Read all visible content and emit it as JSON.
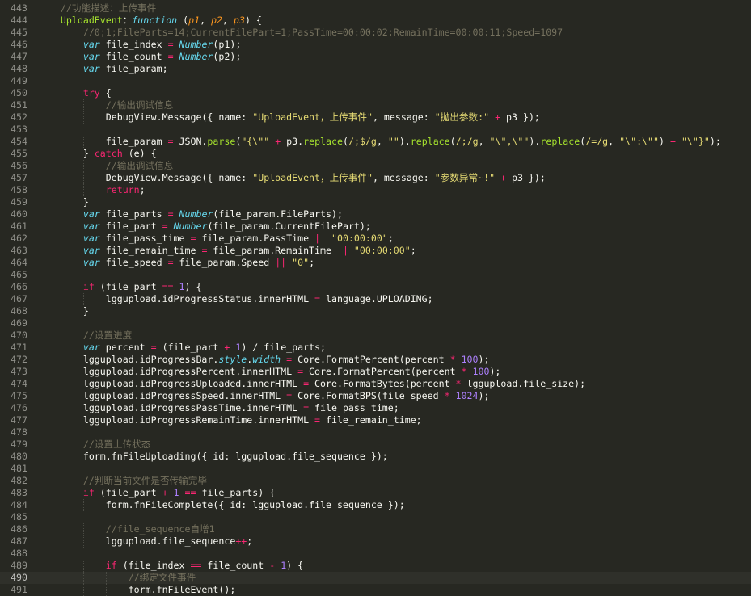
{
  "editor": {
    "current_line": "490",
    "lines": [
      {
        "no": "443",
        "ind": 4,
        "t": [
          [
            "c",
            "//功能描述：上传事件"
          ]
        ]
      },
      {
        "no": "444",
        "ind": 4,
        "t": [
          [
            "f",
            "UploadEvent"
          ],
          [
            "",
            "："
          ],
          [
            "b",
            "function"
          ],
          [
            "",
            " ("
          ],
          [
            "p",
            "p1"
          ],
          [
            "",
            ", "
          ],
          [
            "p",
            "p2"
          ],
          [
            "",
            ", "
          ],
          [
            "p",
            "p3"
          ],
          [
            "",
            ") {"
          ]
        ]
      },
      {
        "no": "445",
        "ind": 8,
        "t": [
          [
            "c",
            "//0;1;FileParts=14;CurrentFilePart=1;PassTime=00:00:02;RemainTime=00:00:11;Speed=1097"
          ]
        ]
      },
      {
        "no": "446",
        "ind": 8,
        "t": [
          [
            "b",
            "var"
          ],
          [
            "",
            " file_index "
          ],
          [
            "k",
            "="
          ],
          [
            "",
            " "
          ],
          [
            "b",
            "Number"
          ],
          [
            "",
            "(p1);"
          ]
        ]
      },
      {
        "no": "447",
        "ind": 8,
        "t": [
          [
            "b",
            "var"
          ],
          [
            "",
            " file_count "
          ],
          [
            "k",
            "="
          ],
          [
            "",
            " "
          ],
          [
            "b",
            "Number"
          ],
          [
            "",
            "(p2);"
          ]
        ]
      },
      {
        "no": "448",
        "ind": 8,
        "t": [
          [
            "b",
            "var"
          ],
          [
            "",
            " file_param;"
          ]
        ]
      },
      {
        "no": "449",
        "ind": 0,
        "t": []
      },
      {
        "no": "450",
        "ind": 8,
        "t": [
          [
            "k",
            "try"
          ],
          [
            "",
            " {"
          ]
        ]
      },
      {
        "no": "451",
        "ind": 12,
        "t": [
          [
            "c",
            "//输出调试信息"
          ]
        ]
      },
      {
        "no": "452",
        "ind": 12,
        "t": [
          [
            "",
            "DebugView.Message({ name: "
          ],
          [
            "s",
            "\"UploadEvent，上传事件\""
          ],
          [
            "",
            ", message: "
          ],
          [
            "s",
            "\"抛出参数:\""
          ],
          [
            "",
            " "
          ],
          [
            "k",
            "+"
          ],
          [
            "",
            " p3 });"
          ]
        ]
      },
      {
        "no": "453",
        "ind": 0,
        "t": []
      },
      {
        "no": "454",
        "ind": 12,
        "t": [
          [
            "",
            "file_param "
          ],
          [
            "k",
            "="
          ],
          [
            "",
            " JSON."
          ],
          [
            "f",
            "parse"
          ],
          [
            "",
            "("
          ],
          [
            "s",
            "\"{\\\"\""
          ],
          [
            "",
            " "
          ],
          [
            "k",
            "+"
          ],
          [
            "",
            " p3."
          ],
          [
            "f",
            "replace"
          ],
          [
            "",
            "("
          ],
          [
            "s",
            "/;$/g"
          ],
          [
            "",
            ", "
          ],
          [
            "s",
            "\"\""
          ],
          [
            "",
            ")."
          ],
          [
            "f",
            "replace"
          ],
          [
            "",
            "("
          ],
          [
            "s",
            "/;/g"
          ],
          [
            "",
            ", "
          ],
          [
            "s",
            "\"\\\",\\\"\""
          ],
          [
            "",
            ")."
          ],
          [
            "f",
            "replace"
          ],
          [
            "",
            "("
          ],
          [
            "s",
            "/=/g"
          ],
          [
            "",
            ", "
          ],
          [
            "s",
            "\"\\\":\\\"\""
          ],
          [
            "",
            ") "
          ],
          [
            "k",
            "+"
          ],
          [
            "",
            " "
          ],
          [
            "s",
            "\"\\\"}\""
          ],
          [
            "",
            ");"
          ]
        ]
      },
      {
        "no": "455",
        "ind": 8,
        "t": [
          [
            "",
            "} "
          ],
          [
            "k",
            "catch"
          ],
          [
            "",
            " (e) {"
          ]
        ]
      },
      {
        "no": "456",
        "ind": 12,
        "t": [
          [
            "c",
            "//输出调试信息"
          ]
        ]
      },
      {
        "no": "457",
        "ind": 12,
        "t": [
          [
            "",
            "DebugView.Message({ name: "
          ],
          [
            "s",
            "\"UploadEvent，上传事件\""
          ],
          [
            "",
            ", message: "
          ],
          [
            "s",
            "\"参数异常~!\""
          ],
          [
            "",
            " "
          ],
          [
            "k",
            "+"
          ],
          [
            "",
            " p3 });"
          ]
        ]
      },
      {
        "no": "458",
        "ind": 12,
        "t": [
          [
            "k",
            "return"
          ],
          [
            "",
            ";"
          ]
        ]
      },
      {
        "no": "459",
        "ind": 8,
        "t": [
          [
            "",
            "}"
          ]
        ]
      },
      {
        "no": "460",
        "ind": 8,
        "t": [
          [
            "b",
            "var"
          ],
          [
            "",
            " file_parts "
          ],
          [
            "k",
            "="
          ],
          [
            "",
            " "
          ],
          [
            "b",
            "Number"
          ],
          [
            "",
            "(file_param.FileParts);"
          ]
        ]
      },
      {
        "no": "461",
        "ind": 8,
        "t": [
          [
            "b",
            "var"
          ],
          [
            "",
            " file_part "
          ],
          [
            "k",
            "="
          ],
          [
            "",
            " "
          ],
          [
            "b",
            "Number"
          ],
          [
            "",
            "(file_param.CurrentFilePart);"
          ]
        ]
      },
      {
        "no": "462",
        "ind": 8,
        "t": [
          [
            "b",
            "var"
          ],
          [
            "",
            " file_pass_time "
          ],
          [
            "k",
            "="
          ],
          [
            "",
            " file_param.PassTime "
          ],
          [
            "k",
            "||"
          ],
          [
            "",
            " "
          ],
          [
            "s",
            "\"00:00:00\""
          ],
          [
            "",
            ";"
          ]
        ]
      },
      {
        "no": "463",
        "ind": 8,
        "t": [
          [
            "b",
            "var"
          ],
          [
            "",
            " file_remain_time "
          ],
          [
            "k",
            "="
          ],
          [
            "",
            " file_param.RemainTime "
          ],
          [
            "k",
            "||"
          ],
          [
            "",
            " "
          ],
          [
            "s",
            "\"00:00:00\""
          ],
          [
            "",
            ";"
          ]
        ]
      },
      {
        "no": "464",
        "ind": 8,
        "t": [
          [
            "b",
            "var"
          ],
          [
            "",
            " file_speed "
          ],
          [
            "k",
            "="
          ],
          [
            "",
            " file_param.Speed "
          ],
          [
            "k",
            "||"
          ],
          [
            "",
            " "
          ],
          [
            "s",
            "\"0\""
          ],
          [
            "",
            ";"
          ]
        ]
      },
      {
        "no": "465",
        "ind": 0,
        "t": []
      },
      {
        "no": "466",
        "ind": 8,
        "t": [
          [
            "k",
            "if"
          ],
          [
            "",
            " (file_part "
          ],
          [
            "k",
            "=="
          ],
          [
            "",
            " "
          ],
          [
            "n",
            "1"
          ],
          [
            "",
            ") {"
          ]
        ]
      },
      {
        "no": "467",
        "ind": 12,
        "t": [
          [
            "",
            "lggupload.idProgressStatus.innerHTML "
          ],
          [
            "k",
            "="
          ],
          [
            "",
            " language.UPLOADING;"
          ]
        ]
      },
      {
        "no": "468",
        "ind": 8,
        "t": [
          [
            "",
            "}"
          ]
        ]
      },
      {
        "no": "469",
        "ind": 0,
        "t": []
      },
      {
        "no": "470",
        "ind": 8,
        "t": [
          [
            "c",
            "//设置进度"
          ]
        ]
      },
      {
        "no": "471",
        "ind": 8,
        "t": [
          [
            "b",
            "var"
          ],
          [
            "",
            " percent "
          ],
          [
            "k",
            "="
          ],
          [
            "",
            " (file_part "
          ],
          [
            "k",
            "+"
          ],
          [
            "",
            " "
          ],
          [
            "n",
            "1"
          ],
          [
            "",
            ") / file_parts;"
          ]
        ]
      },
      {
        "no": "472",
        "ind": 8,
        "t": [
          [
            "",
            "lggupload.idProgressBar."
          ],
          [
            "b",
            "style"
          ],
          [
            "",
            "."
          ],
          [
            "b",
            "width"
          ],
          [
            "",
            " "
          ],
          [
            "k",
            "="
          ],
          [
            "",
            " Core.FormatPercent(percent "
          ],
          [
            "k",
            "*"
          ],
          [
            "",
            " "
          ],
          [
            "n",
            "100"
          ],
          [
            "",
            ");"
          ]
        ]
      },
      {
        "no": "473",
        "ind": 8,
        "t": [
          [
            "",
            "lggupload.idProgressPercent.innerHTML "
          ],
          [
            "k",
            "="
          ],
          [
            "",
            " Core.FormatPercent(percent "
          ],
          [
            "k",
            "*"
          ],
          [
            "",
            " "
          ],
          [
            "n",
            "100"
          ],
          [
            "",
            ");"
          ]
        ]
      },
      {
        "no": "474",
        "ind": 8,
        "t": [
          [
            "",
            "lggupload.idProgressUploaded.innerHTML "
          ],
          [
            "k",
            "="
          ],
          [
            "",
            " Core.FormatBytes(percent "
          ],
          [
            "k",
            "*"
          ],
          [
            "",
            " lggupload.file_size);"
          ]
        ]
      },
      {
        "no": "475",
        "ind": 8,
        "t": [
          [
            "",
            "lggupload.idProgressSpeed.innerHTML "
          ],
          [
            "k",
            "="
          ],
          [
            "",
            " Core.FormatBPS(file_speed "
          ],
          [
            "k",
            "*"
          ],
          [
            "",
            " "
          ],
          [
            "n",
            "1024"
          ],
          [
            "",
            ");"
          ]
        ]
      },
      {
        "no": "476",
        "ind": 8,
        "t": [
          [
            "",
            "lggupload.idProgressPassTime.innerHTML "
          ],
          [
            "k",
            "="
          ],
          [
            "",
            " file_pass_time;"
          ]
        ]
      },
      {
        "no": "477",
        "ind": 8,
        "t": [
          [
            "",
            "lggupload.idProgressRemainTime.innerHTML "
          ],
          [
            "k",
            "="
          ],
          [
            "",
            " file_remain_time;"
          ]
        ]
      },
      {
        "no": "478",
        "ind": 0,
        "t": []
      },
      {
        "no": "479",
        "ind": 8,
        "t": [
          [
            "c",
            "//设置上传状态"
          ]
        ]
      },
      {
        "no": "480",
        "ind": 8,
        "t": [
          [
            "",
            "form.fnFileUploading({ id: lggupload.file_sequence });"
          ]
        ]
      },
      {
        "no": "481",
        "ind": 0,
        "t": []
      },
      {
        "no": "482",
        "ind": 8,
        "t": [
          [
            "c",
            "//判断当前文件是否传输完毕"
          ]
        ]
      },
      {
        "no": "483",
        "ind": 8,
        "t": [
          [
            "k",
            "if"
          ],
          [
            "",
            " (file_part "
          ],
          [
            "k",
            "+"
          ],
          [
            "",
            " "
          ],
          [
            "n",
            "1"
          ],
          [
            "",
            " "
          ],
          [
            "k",
            "=="
          ],
          [
            "",
            " file_parts) {"
          ]
        ]
      },
      {
        "no": "484",
        "ind": 12,
        "t": [
          [
            "",
            "form.fnFileComplete({ id: lggupload.file_sequence });"
          ]
        ]
      },
      {
        "no": "485",
        "ind": 0,
        "t": []
      },
      {
        "no": "486",
        "ind": 12,
        "t": [
          [
            "c",
            "//file_sequence自增1"
          ]
        ]
      },
      {
        "no": "487",
        "ind": 12,
        "t": [
          [
            "",
            "lggupload.file_sequence"
          ],
          [
            "k",
            "++"
          ],
          [
            "",
            ";"
          ]
        ]
      },
      {
        "no": "488",
        "ind": 0,
        "t": []
      },
      {
        "no": "489",
        "ind": 12,
        "t": [
          [
            "k",
            "if"
          ],
          [
            "",
            " (file_index "
          ],
          [
            "k",
            "=="
          ],
          [
            "",
            " file_count "
          ],
          [
            "k",
            "-"
          ],
          [
            "",
            " "
          ],
          [
            "n",
            "1"
          ],
          [
            "",
            ") {"
          ]
        ]
      },
      {
        "no": "490",
        "ind": 16,
        "t": [
          [
            "c",
            "//绑定文件事件"
          ]
        ]
      },
      {
        "no": "491",
        "ind": 16,
        "t": [
          [
            "",
            "form.fnFileEvent();"
          ]
        ]
      }
    ]
  }
}
